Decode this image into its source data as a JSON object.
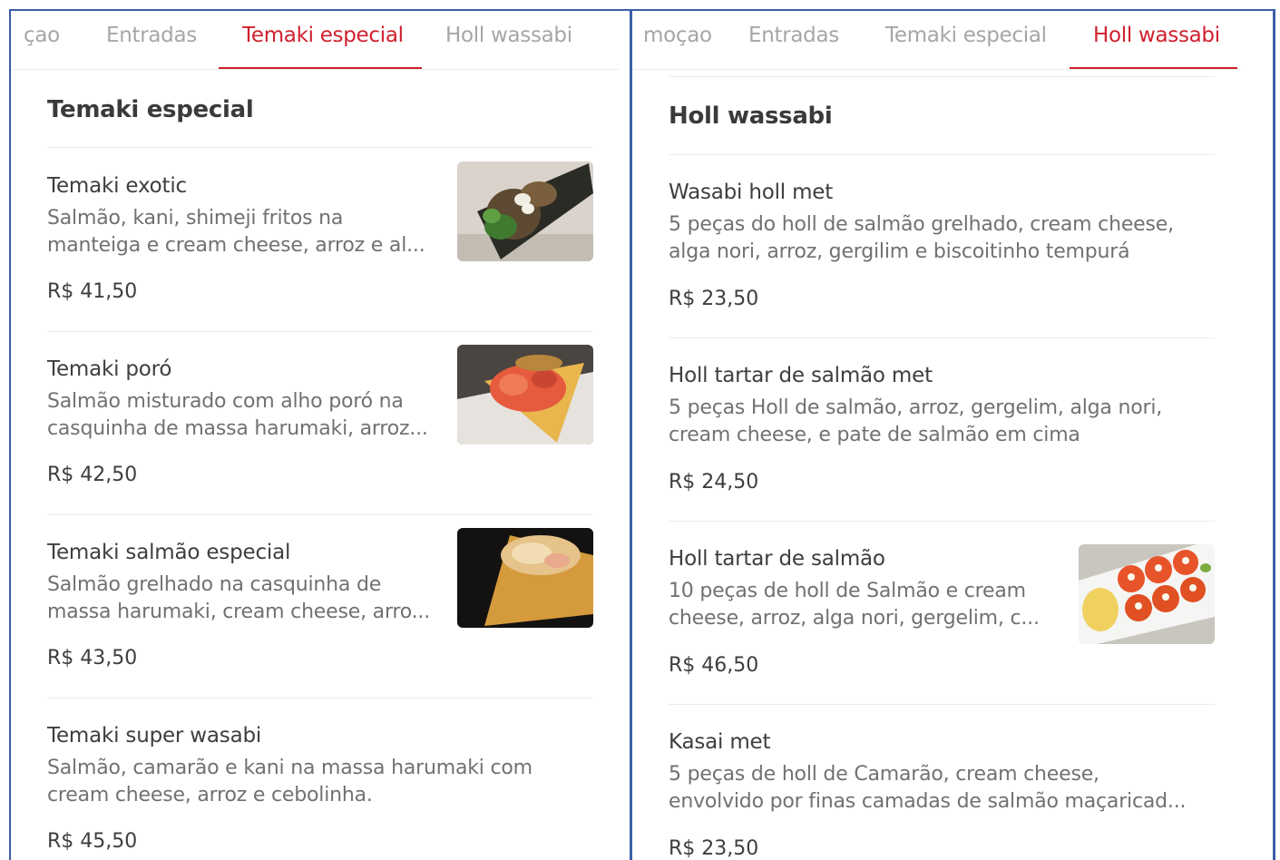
{
  "left": {
    "tabs": [
      "çao",
      "Entradas",
      "Temaki especial",
      "Holl wassabi"
    ],
    "active_tab": "Temaki especial",
    "section_title": "Temaki especial",
    "items": [
      {
        "name": "Temaki exotic",
        "desc_line1": "Salmão, kani, shimeji fritos na",
        "desc_line2": "manteiga e cream cheese, arroz e al...",
        "price": "R$ 41,50",
        "image": "temaki-exotic-photo"
      },
      {
        "name": "Temaki poró",
        "desc_line1": "Salmão misturado com alho poró na",
        "desc_line2": "casquinha de massa harumaki, arroz...",
        "price": "R$ 42,50",
        "image": "temaki-poro-photo"
      },
      {
        "name": "Temaki salmão especial",
        "desc_line1": "Salmão grelhado na casquinha de",
        "desc_line2": "massa harumaki, cream cheese, arro...",
        "price": "R$ 43,50",
        "image": "temaki-salmao-especial-photo"
      },
      {
        "name": "Temaki super wasabi",
        "desc_line1": "Salmão, camarão e kani na massa harumaki com",
        "desc_line2": "cream cheese, arroz e cebolinha.",
        "price": "R$ 45,50"
      }
    ]
  },
  "right": {
    "tabs": [
      "moçao",
      "Entradas",
      "Temaki especial",
      "Holl wassabi"
    ],
    "active_tab": "Holl wassabi",
    "section_title": "Holl wassabi",
    "items": [
      {
        "name": "Wasabi holl met",
        "desc_line1": "5 peças do holl de salmão grelhado, cream cheese,",
        "desc_line2": "alga nori, arroz, gergilim e biscoitinho tempurá",
        "price": "R$ 23,50"
      },
      {
        "name": "Holl tartar de salmão met",
        "desc_line1": "5 peças Holl de salmão, arroz, gergelim, alga nori,",
        "desc_line2": "cream cheese, e pate de salmão em cima",
        "price": "R$ 24,50"
      },
      {
        "name": "Holl tartar de salmão",
        "desc_line1": "10 peças de holl de Salmão e cream",
        "desc_line2": "cheese, arroz, alga nori, gergelim, c...",
        "price": "R$ 46,50",
        "image": "holl-tartar-photo"
      },
      {
        "name": "Kasai met",
        "desc_line1": "5 peças de holl de Camarão, cream cheese,",
        "desc_line2": "envolvido por finas camadas de salmão maçaricad...",
        "price": "R$ 23,50"
      }
    ]
  },
  "colors": {
    "accent": "#d0202e",
    "frame": "#3a5ea8",
    "inactive_tab": "#a6a6a6",
    "description": "#717171"
  }
}
